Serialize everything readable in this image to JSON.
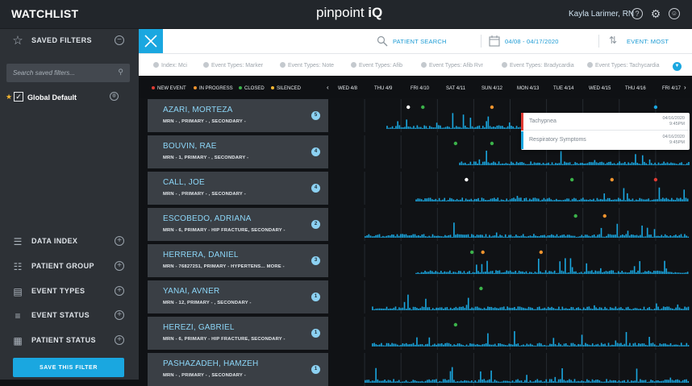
{
  "app": {
    "title": "WATCHLIST",
    "brand_text": "pinpoint",
    "brand_mark": "iQ",
    "user_name": "Kayla Larimer, RN",
    "accent": "#1aa7e0"
  },
  "sidebar": {
    "saved_filters_label": "SAVED FILTERS",
    "search_placeholder": "Search saved filters...",
    "global_default_label": "Global Default",
    "sections": [
      {
        "label": "DATA INDEX",
        "icon": "sliders-icon"
      },
      {
        "label": "PATIENT GROUP",
        "icon": "patient-group-icon"
      },
      {
        "label": "EVENT TYPES",
        "icon": "document-icon"
      },
      {
        "label": "EVENT STATUS",
        "icon": "event-status-icon"
      },
      {
        "label": "PATIENT STATUS",
        "icon": "clipboard-icon"
      }
    ],
    "save_button_label": "SAVE THIS FILTER"
  },
  "toolbar": {
    "patient_search_label": "PATIENT SEARCH",
    "date_range": "04/08 - 04/17/2020",
    "sort_label": "EVENT: MOST"
  },
  "chips": [
    "Index: Mci",
    "Event Types: Marker",
    "Event Types: Note",
    "Event Types: Afib",
    "Event Types: Afib Rvr",
    "Event Types: Bradycardia",
    "Event Types: Tachycardia"
  ],
  "legend": [
    {
      "label": "NEW EVENT",
      "color": "#e03b33"
    },
    {
      "label": "IN PROGRESS",
      "color": "#f0942e"
    },
    {
      "label": "CLOSED",
      "color": "#3bb34a"
    },
    {
      "label": "SILENCED",
      "color": "#f5b731"
    }
  ],
  "dates": [
    "WED 4/8",
    "THU 4/9",
    "FRI 4/10",
    "SAT 4/11",
    "SUN 4/12",
    "MON 4/13",
    "TUE 4/14",
    "WED 4/15",
    "THU 4/16",
    "FRI 4/17"
  ],
  "patients": [
    {
      "name": "AZARI, MORTEZA",
      "details": "MRN - , PRIMARY - , SECONDARY -",
      "count": "5",
      "events": [
        {
          "day": 2.2,
          "color": "#ffffff"
        },
        {
          "day": 2.6,
          "color": "#3bb34a"
        },
        {
          "day": 4.5,
          "color": "#f0942e"
        },
        {
          "day": 9.0,
          "color": "#1aa7e0"
        }
      ]
    },
    {
      "name": "BOUVIN, RAE",
      "details": "MRN - 1, PRIMARY - , SECONDARY -",
      "count": "4",
      "events": [
        {
          "day": 3.5,
          "color": "#3bb34a"
        },
        {
          "day": 4.5,
          "color": "#3bb34a"
        },
        {
          "day": 6.1,
          "color": "#f0942e"
        },
        {
          "day": 9.2,
          "color": "#3bb34a"
        }
      ]
    },
    {
      "name": "CALL, JOE",
      "details": "MRN - , PRIMARY - , SECONDARY -",
      "count": "4",
      "events": [
        {
          "day": 3.8,
          "color": "#ffffff"
        },
        {
          "day": 6.7,
          "color": "#3bb34a"
        },
        {
          "day": 7.8,
          "color": "#f0942e"
        },
        {
          "day": 9.0,
          "color": "#e03b33"
        }
      ]
    },
    {
      "name": "ESCOBEDO, ADRIANA",
      "details": "MRN - 6, PRIMARY - HIP FRACTURE, SECONDARY -",
      "count": "2",
      "events": [
        {
          "day": 6.8,
          "color": "#3bb34a"
        },
        {
          "day": 7.6,
          "color": "#f0942e"
        }
      ]
    },
    {
      "name": "HERRERA, DANIEL",
      "details": "MRN - 76827251, PRIMARY - HYPERTENS... MORE -",
      "count": "3",
      "events": [
        {
          "day": 3.95,
          "color": "#3bb34a"
        },
        {
          "day": 4.25,
          "color": "#f0942e"
        },
        {
          "day": 5.85,
          "color": "#f0942e"
        }
      ]
    },
    {
      "name": "YANAI, AVNER",
      "details": "MRN - 12, PRIMARY - , SECONDARY -",
      "count": "1",
      "events": [
        {
          "day": 4.2,
          "color": "#3bb34a"
        }
      ]
    },
    {
      "name": "HEREZI, GABRIEL",
      "details": "MRN - 6, PRIMARY - HIP FRACTURE, SECONDARY -",
      "count": "1",
      "events": [
        {
          "day": 3.5,
          "color": "#3bb34a"
        }
      ]
    },
    {
      "name": "PASHAZADEH, HAMZEH",
      "details": "MRN - , PRIMARY - , SECONDARY -",
      "count": "1",
      "events": []
    }
  ],
  "tooltip": {
    "items": [
      {
        "label": "Tachypnea",
        "date": "04/16/2020",
        "time": "9:45PM",
        "color": "#e03b33"
      },
      {
        "label": "Respiratory Symptoms",
        "date": "04/16/2020",
        "time": "9:45PM",
        "color": "#1aa7e0"
      }
    ]
  }
}
